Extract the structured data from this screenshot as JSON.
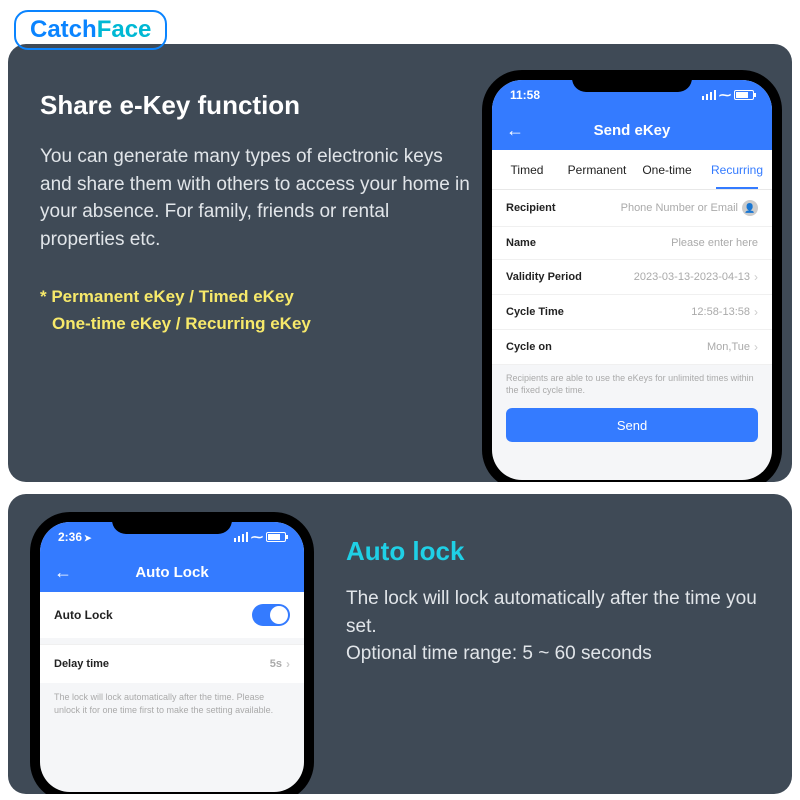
{
  "brand": {
    "part1": "Catch",
    "part2": "Face"
  },
  "section1": {
    "heading": "Share e-Key function",
    "description": "You can generate many types of electronic keys and share them with others to access your home in your absence. For family, friends or rental properties etc.",
    "highlight_line1": "* Permanent eKey /  Timed eKey",
    "highlight_line2": "One-time eKey /  Recurring eKey"
  },
  "phone1": {
    "time": "11:58",
    "title": "Send eKey",
    "tabs": [
      "Timed",
      "Permanent",
      "One-time",
      "Recurring"
    ],
    "active_tab": 3,
    "rows": {
      "recipient_label": "Recipient",
      "recipient_placeholder": "Phone Number or Email",
      "name_label": "Name",
      "name_placeholder": "Please enter here",
      "validity_label": "Validity Period",
      "validity_value": "2023-03-13-2023-04-13",
      "cycle_time_label": "Cycle Time",
      "cycle_time_value": "12:58-13:58",
      "cycle_on_label": "Cycle on",
      "cycle_on_value": "Mon,Tue"
    },
    "note": "Recipients are able to use the eKeys for unlimited times within the fixed cycle time.",
    "send_label": "Send"
  },
  "section2": {
    "heading": "Auto lock",
    "line1": "The lock will lock automatically after the time you set.",
    "line2": "Optional time range: 5 ~ 60 seconds"
  },
  "phone2": {
    "time": "2:36",
    "title": "Auto Lock",
    "auto_lock_label": "Auto Lock",
    "delay_label": "Delay time",
    "delay_value": "5s",
    "note": "The lock will lock automatically after the time. Please unlock it for one time first to make the setting available."
  }
}
